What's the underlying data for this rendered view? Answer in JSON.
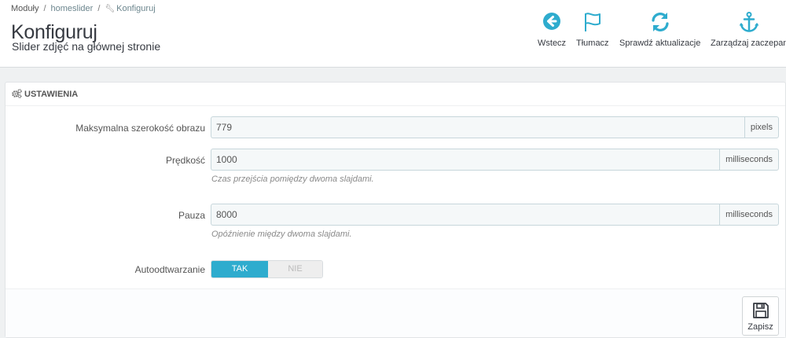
{
  "breadcrumb": {
    "items": [
      "Moduły",
      "homeslider",
      "Konfiguruj"
    ]
  },
  "header": {
    "title": "Konfiguruj",
    "subtitle": "Slider zdjęć na głównej stronie"
  },
  "toolbar": {
    "back_label": "Wstecz",
    "translate_label": "Tłumacz",
    "updates_label": "Sprawdź aktualizacje",
    "hooks_label": "Zarządzaj zaczepan"
  },
  "settings": {
    "heading": "USTAWIENIA",
    "fields": [
      {
        "label": "Maksymalna szerokość obrazu",
        "value": "779",
        "unit": "pixels",
        "help": ""
      },
      {
        "label": "Prędkość",
        "value": "1000",
        "unit": "milliseconds",
        "help": "Czas przejścia pomiędzy dwoma slajdami."
      },
      {
        "label": "Pauza",
        "value": "8000",
        "unit": "milliseconds",
        "help": "Opóźnienie między dwoma slajdami."
      }
    ],
    "autoplay": {
      "label": "Autoodtwarzanie",
      "on_label": "TAK",
      "off_label": "NIE"
    }
  },
  "footer": {
    "save_label": "Zapisz"
  },
  "colors": {
    "accent": "#2eacce",
    "title": "#363a41"
  }
}
